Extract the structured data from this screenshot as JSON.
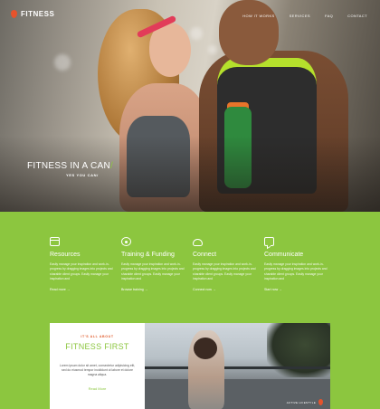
{
  "brand": {
    "name": "FITNESS",
    "tagline_small": "—————",
    "accent": "#8cc63f",
    "logo_color": "#e6532c"
  },
  "nav": {
    "items": [
      "HOW IT WORKS",
      "SERVICES",
      "FAQ",
      "CONTACT"
    ]
  },
  "hero": {
    "headline": "FITNESS IN A CAN",
    "headline_slash": "/",
    "subline": "YES YOU CAN/"
  },
  "features": [
    {
      "icon": "calendar-icon",
      "title": "Resources",
      "text": "Easily manage your inspiration and work-in-progress by dragging images into projects and sharable client groups. Easily manage your inspiration and",
      "link": "Read more →"
    },
    {
      "icon": "target-icon",
      "title": "Training & Funding",
      "text": "Easily manage your inspiration and work-in-progress by dragging images into projects and sharable client groups. Easily manage your inspiration and",
      "link": "Browse training →"
    },
    {
      "icon": "cloud-icon",
      "title": "Connect",
      "text": "Easily manage your inspiration and work-in-progress by dragging images into projects and sharable client groups. Easily manage your inspiration and",
      "link": "Connect now →"
    },
    {
      "icon": "chat-icon",
      "title": "Communicate",
      "text": "Easily manage your inspiration and work-in-progress by dragging images into projects and sharable client groups. Easily manage your inspiration and",
      "link": "Start now →"
    }
  ],
  "promo": {
    "eyebrow": "IT'S ALL ABOUT",
    "title": "FITNESS FIRST",
    "text": "Lorem ipsum dolor sit amet, consectetur adipisicing elit, sed do eiusmod tempor incididunt ut labore et dolore magna aliqua.",
    "link": "Read More",
    "badge": "ACTIVE LIFESTYLE"
  }
}
